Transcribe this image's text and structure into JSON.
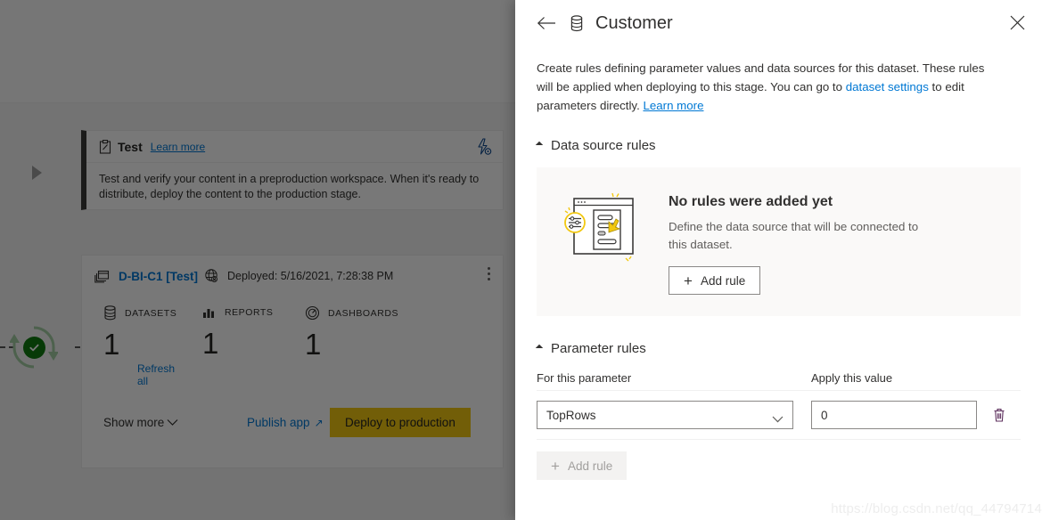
{
  "background": {
    "stage_card": {
      "title": "Test",
      "learn_more": "Learn more",
      "description": "Test and verify your content in a preproduction workspace. When it's ready to distribute, deploy the content to the production stage.",
      "settings_icon": "lightning-settings-icon",
      "stage_icon": "clipboard-icon"
    },
    "content_card": {
      "workspace_name": "D-BI-C1 [Test]",
      "deployed_label": "Deployed: 5/16/2021, 7:28:38 PM",
      "stack_icon": "stacked-windows-icon",
      "globe_icon": "globe-search-icon",
      "more_icon": "more-vertical-icon",
      "metrics": [
        {
          "icon": "database-icon",
          "label": "DATASETS",
          "value": "1",
          "action": "Refresh all"
        },
        {
          "icon": "bar-chart-icon",
          "label": "REPORTS",
          "value": "1",
          "action": ""
        },
        {
          "icon": "gauge-icon",
          "label": "DASHBOARDS",
          "value": "1",
          "action": ""
        }
      ],
      "show_more": "Show more",
      "publish_app": "Publish app",
      "publish_app_arrow": "↗",
      "deploy_button": "Deploy to production",
      "deploy_button_color": "#f2c811"
    },
    "connector": {
      "status_icon": "refresh-success-icon",
      "status_color": "#107c10"
    },
    "expand_arrow_icon": "expand-right-arrow-icon"
  },
  "panel": {
    "back_icon": "back-arrow-icon",
    "dataset_icon": "database-icon",
    "title": "Customer",
    "close_icon": "close-icon",
    "description": {
      "part1": "Create rules defining parameter values and data sources for this dataset. These rules will be applied when deploying to this stage. You can go to ",
      "link1": "dataset settings",
      "part2": " to edit parameters directly. ",
      "link2": "Learn more"
    },
    "data_source_rules": {
      "section_title": "Data source rules",
      "empty_illustration": "rules-document-illustration",
      "empty_title": "No rules were added yet",
      "empty_subtitle": "Define the data source that will be connected to this dataset.",
      "add_rule_button": "Add rule",
      "add_rule_plus": "+"
    },
    "parameter_rules": {
      "section_title": "Parameter rules",
      "col_parameter": "For this parameter",
      "col_value": "Apply this value",
      "rows": [
        {
          "parameter": "TopRows",
          "value": "0",
          "delete_icon": "trash-icon"
        }
      ],
      "add_rule_button": "Add rule",
      "add_rule_plus": "+"
    }
  },
  "watermark": "https://blog.csdn.net/qq_44794714"
}
